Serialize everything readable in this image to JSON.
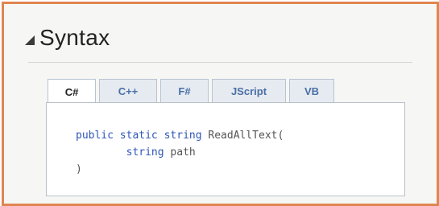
{
  "section": {
    "title": "Syntax"
  },
  "tabs": [
    {
      "label": "C#",
      "active": true
    },
    {
      "label": "C++",
      "active": false
    },
    {
      "label": "F#",
      "active": false
    },
    {
      "label": "JScript",
      "active": false
    },
    {
      "label": "VB",
      "active": false
    }
  ],
  "code": {
    "line1": {
      "kw1": "public",
      "kw2": "static",
      "kw3": "string",
      "text": "ReadAllText("
    },
    "line2": {
      "kw": "string",
      "text": "path"
    },
    "line3": {
      "text": ")"
    }
  },
  "colors": {
    "frame_border": "#e0854f",
    "keyword": "#2f56b8",
    "tab_text": "#4a6fa5"
  }
}
